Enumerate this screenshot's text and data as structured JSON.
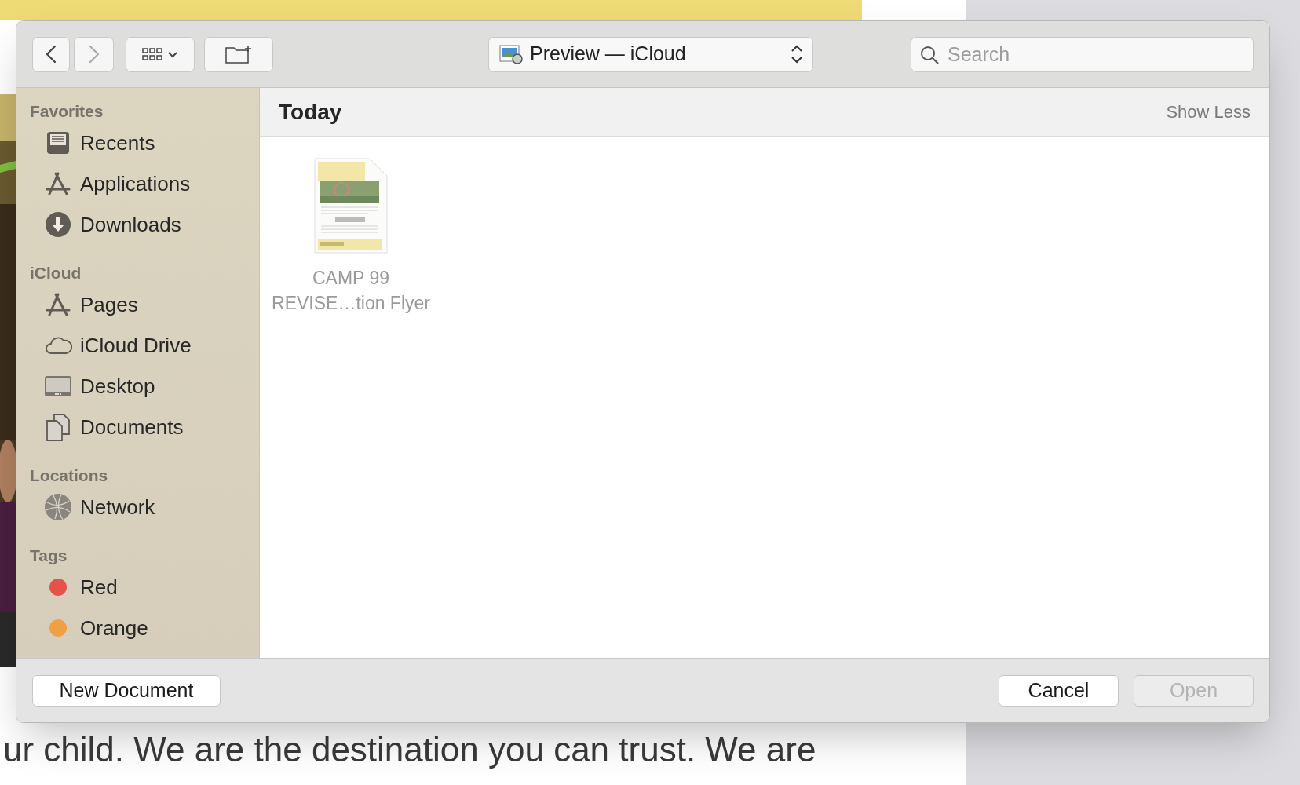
{
  "background": {
    "body_text": "ur child. We are the destination you can trust. We are"
  },
  "dialog": {
    "toolbar": {
      "back": {
        "disabled": false
      },
      "forward": {
        "disabled": true
      },
      "location": "Preview — iCloud",
      "search": {
        "placeholder": "Search"
      }
    },
    "sidebar": {
      "sections": [
        {
          "title": "Favorites",
          "items": [
            {
              "label": "Recents",
              "kind": "recents"
            },
            {
              "label": "Applications",
              "kind": "apps"
            },
            {
              "label": "Downloads",
              "kind": "downloads"
            }
          ]
        },
        {
          "title": "iCloud",
          "items": [
            {
              "label": "Pages",
              "kind": "apps"
            },
            {
              "label": "iCloud Drive",
              "kind": "cloud"
            },
            {
              "label": "Desktop",
              "kind": "desktop"
            },
            {
              "label": "Documents",
              "kind": "documents"
            }
          ]
        },
        {
          "title": "Locations",
          "items": [
            {
              "label": "Network",
              "kind": "network"
            }
          ]
        },
        {
          "title": "Tags",
          "items": [
            {
              "label": "Red",
              "kind": "tag",
              "color": "#e5524b"
            },
            {
              "label": "Orange",
              "kind": "tag",
              "color": "#f0a044"
            }
          ]
        }
      ]
    },
    "group": {
      "title": "Today",
      "action": "Show Less"
    },
    "files": [
      {
        "name_lines": [
          "CAMP 99",
          "REVISE…tion Flyer"
        ]
      }
    ],
    "footer": {
      "left_button": {
        "label": "New Document",
        "disabled": false
      },
      "right_buttons": [
        {
          "label": "Cancel",
          "disabled": false
        },
        {
          "label": "Open",
          "disabled": true
        }
      ]
    }
  }
}
